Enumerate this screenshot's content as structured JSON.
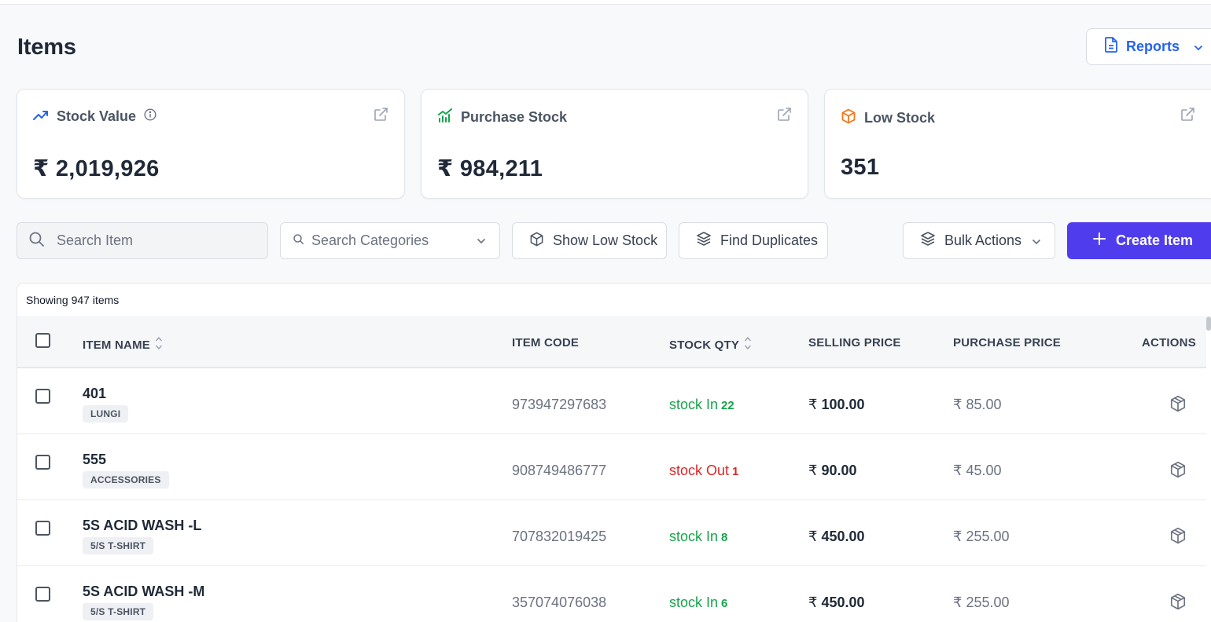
{
  "page": {
    "title": "Items"
  },
  "reports": {
    "label": "Reports"
  },
  "cards": {
    "stock_value": {
      "label": "Stock Value",
      "value": "₹ 2,019,926"
    },
    "purchase_stock": {
      "label": "Purchase Stock",
      "value": "₹ 984,211"
    },
    "low_stock": {
      "label": "Low Stock",
      "value": "351"
    }
  },
  "toolbar": {
    "search_item_placeholder": "Search Item",
    "search_categories_placeholder": "Search Categories",
    "show_low_stock": "Show Low Stock",
    "find_duplicates": "Find Duplicates",
    "bulk_actions": "Bulk Actions",
    "create_item": "Create Item"
  },
  "table": {
    "showing": "Showing 947 items",
    "headers": {
      "item_name": "ITEM NAME",
      "item_code": "ITEM CODE",
      "stock_qty": "STOCK QTY",
      "selling_price": "SELLING PRICE",
      "purchase_price": "PURCHASE PRICE",
      "actions": "ACTIONS"
    },
    "currency": "₹",
    "rows": [
      {
        "name": "401",
        "category": "LUNGI",
        "code": "973947297683",
        "stock_label": "stock In",
        "qty": "22",
        "status": "in",
        "selling": "100.00",
        "purchase": "85.00"
      },
      {
        "name": "555",
        "category": "ACCESSORIES",
        "code": "908749486777",
        "stock_label": "stock Out",
        "qty": "1",
        "status": "out",
        "selling": "90.00",
        "purchase": "45.00"
      },
      {
        "name": "5S ACID WASH -L",
        "category": "5/S T-SHIRT",
        "code": "707832019425",
        "stock_label": "stock In",
        "qty": "8",
        "status": "in",
        "selling": "450.00",
        "purchase": "255.00"
      },
      {
        "name": "5S ACID WASH -M",
        "category": "5/S T-SHIRT",
        "code": "357074076038",
        "stock_label": "stock In",
        "qty": "6",
        "status": "in",
        "selling": "450.00",
        "purchase": "255.00"
      }
    ]
  },
  "colors": {
    "accent": "#4f3ded",
    "link_blue": "#2563eb",
    "stock_in": "#16a34a",
    "stock_out": "#dc2626",
    "low_stock_orange": "#f97316"
  },
  "icons": {
    "reports": "document-icon",
    "stock_value": "trending-up-icon",
    "purchase_stock": "bar-chart-icon",
    "low_stock": "box-icon",
    "external": "external-link-icon",
    "row_action": "box-icon"
  }
}
